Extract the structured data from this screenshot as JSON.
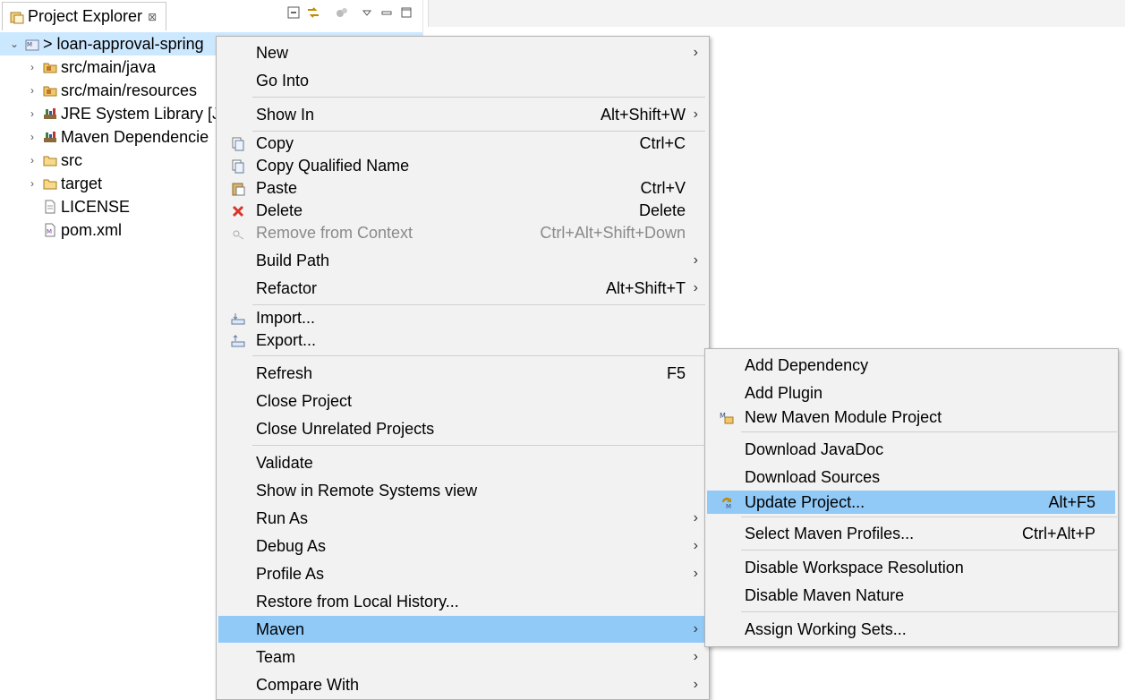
{
  "explorer": {
    "tab_title": "Project Explorer",
    "tab_close": "⊠",
    "tree": [
      {
        "label": "> loan-approval-spring",
        "expanded": true,
        "icon": "maven-project-icon"
      },
      {
        "label": "src/main/java",
        "icon": "source-folder-icon"
      },
      {
        "label": "src/main/resources",
        "icon": "source-folder-icon"
      },
      {
        "label": "JRE System Library [J",
        "icon": "library-icon"
      },
      {
        "label": "Maven Dependencie",
        "icon": "library-icon"
      },
      {
        "label": "src",
        "icon": "folder-icon"
      },
      {
        "label": "target",
        "icon": "folder-icon"
      },
      {
        "label": "LICENSE",
        "icon": "file-icon"
      },
      {
        "label": "pom.xml",
        "icon": "xml-file-icon"
      }
    ]
  },
  "context_menu": {
    "items": [
      {
        "label": "New",
        "shortcut": ""
      },
      {
        "label": "Go Into",
        "shortcut": ""
      },
      {
        "label": "Show In",
        "shortcut": "Alt+Shift+W"
      },
      {
        "label": "Copy",
        "shortcut": "Ctrl+C"
      },
      {
        "label": "Copy Qualified Name",
        "shortcut": ""
      },
      {
        "label": "Paste",
        "shortcut": "Ctrl+V"
      },
      {
        "label": "Delete",
        "shortcut": "Delete"
      },
      {
        "label": "Remove from Context",
        "shortcut": "Ctrl+Alt+Shift+Down"
      },
      {
        "label": "Build Path",
        "shortcut": ""
      },
      {
        "label": "Refactor",
        "shortcut": "Alt+Shift+T"
      },
      {
        "label": "Import...",
        "shortcut": ""
      },
      {
        "label": "Export...",
        "shortcut": ""
      },
      {
        "label": "Refresh",
        "shortcut": "F5"
      },
      {
        "label": "Close Project",
        "shortcut": ""
      },
      {
        "label": "Close Unrelated Projects",
        "shortcut": ""
      },
      {
        "label": "Validate",
        "shortcut": ""
      },
      {
        "label": "Show in Remote Systems view",
        "shortcut": ""
      },
      {
        "label": "Run As",
        "shortcut": ""
      },
      {
        "label": "Debug As",
        "shortcut": ""
      },
      {
        "label": "Profile As",
        "shortcut": ""
      },
      {
        "label": "Restore from Local History...",
        "shortcut": ""
      },
      {
        "label": "Maven",
        "shortcut": ""
      },
      {
        "label": "Team",
        "shortcut": ""
      },
      {
        "label": "Compare With",
        "shortcut": ""
      }
    ],
    "submenu_arrow": "›"
  },
  "maven_menu": {
    "items": [
      {
        "label": "Add Dependency",
        "shortcut": ""
      },
      {
        "label": "Add Plugin",
        "shortcut": ""
      },
      {
        "label": "New Maven Module Project",
        "shortcut": ""
      },
      {
        "label": "Download JavaDoc",
        "shortcut": ""
      },
      {
        "label": "Download Sources",
        "shortcut": ""
      },
      {
        "label": "Update Project...",
        "shortcut": "Alt+F5"
      },
      {
        "label": "Select Maven Profiles...",
        "shortcut": "Ctrl+Alt+P"
      },
      {
        "label": "Disable Workspace Resolution",
        "shortcut": ""
      },
      {
        "label": "Disable Maven Nature",
        "shortcut": ""
      },
      {
        "label": "Assign Working Sets...",
        "shortcut": ""
      }
    ]
  },
  "colors": {
    "highlight": "#91c9f7",
    "selection": "#cce8ff",
    "menu_bg": "#f2f2f2",
    "delete_red": "#d9342b"
  }
}
